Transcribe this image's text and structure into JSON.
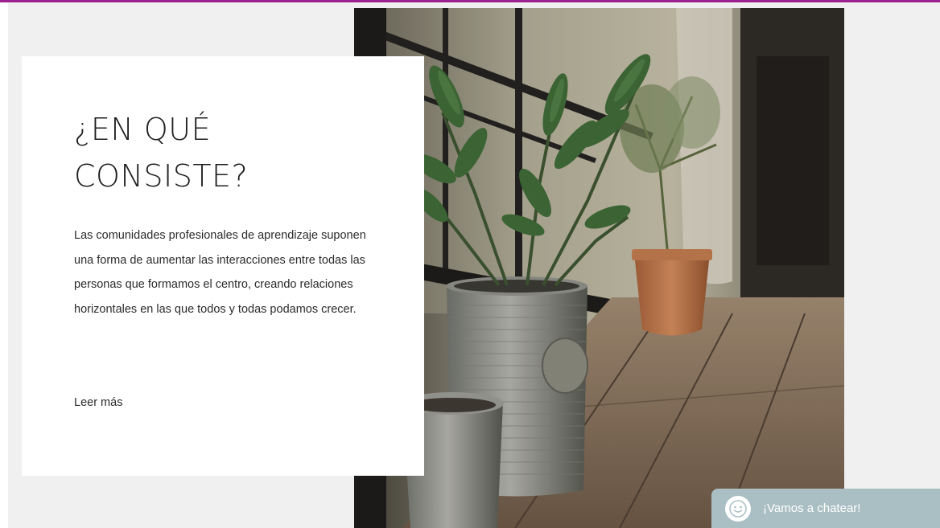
{
  "section": {
    "title_line1": "¿EN QUÉ",
    "title_line2": "CONSISTE?",
    "body": "Las comunidades profesionales de aprendizaje suponen una forma de aumentar las interacciones entre todas las personas que formamos el centro, creando relaciones horizontales en las que todos y todas podamos crecer.",
    "read_more": "Leer más"
  },
  "chat": {
    "label": "¡Vamos a chatear!",
    "icon": "smiley-icon"
  },
  "colors": {
    "accent": "#9b1f8d",
    "chat_bg": "#aabfc4",
    "page_bg": "#f0f0f0"
  }
}
